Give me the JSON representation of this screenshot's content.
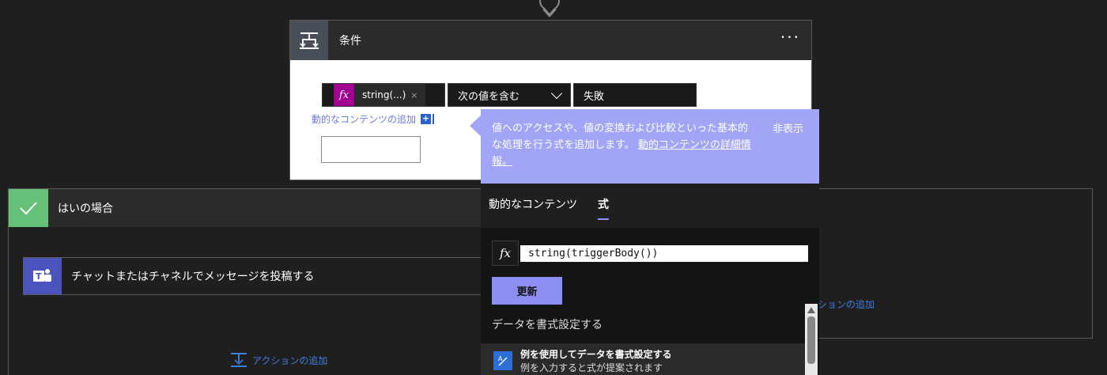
{
  "condition": {
    "title": "条件",
    "menu_label": "···",
    "token_label": "string(...)",
    "token_fx": "fx",
    "token_close": "×",
    "operator": "次の値を含む",
    "value": "失敗",
    "dynamic_link": "動的なコンテンツの追加",
    "dynamic_plus": "+"
  },
  "yes_branch": {
    "title": "はいの場合",
    "teams_action": "チャットまたはチャネルでメッセージを投稿する",
    "add_action": "アクションの追加"
  },
  "no_branch": {
    "add_action": "ションの追加"
  },
  "popup": {
    "info_text": "値へのアクセスや、値の変換および比較といった基本的な処理を行う式を追加します。",
    "info_link": "動的コンテンツの詳細情報。",
    "hide_label": "非表示",
    "tabs": [
      {
        "label": "動的なコンテンツ"
      },
      {
        "label": "式"
      }
    ],
    "expr_fx": "fx",
    "expression": "string(triggerBody())",
    "update_button": "更新",
    "format_section_title": "データを書式設定する",
    "format_item_title": "例を使用してデータを書式設定する",
    "format_item_sub": "例を入力すると式が提案されます"
  },
  "colors": {
    "accent": "#8c8ef0",
    "info_bg": "#a2a5f5",
    "yes_green": "#66c178",
    "token_magenta": "#a0008f",
    "teams_purple": "#4b53bc",
    "link_blue": "#3f7fe0"
  },
  "icons": {
    "condition": "condition-icon",
    "check": "check-icon",
    "teams": "teams-icon",
    "add_action": "add-action-icon",
    "format": "format-data-icon"
  }
}
